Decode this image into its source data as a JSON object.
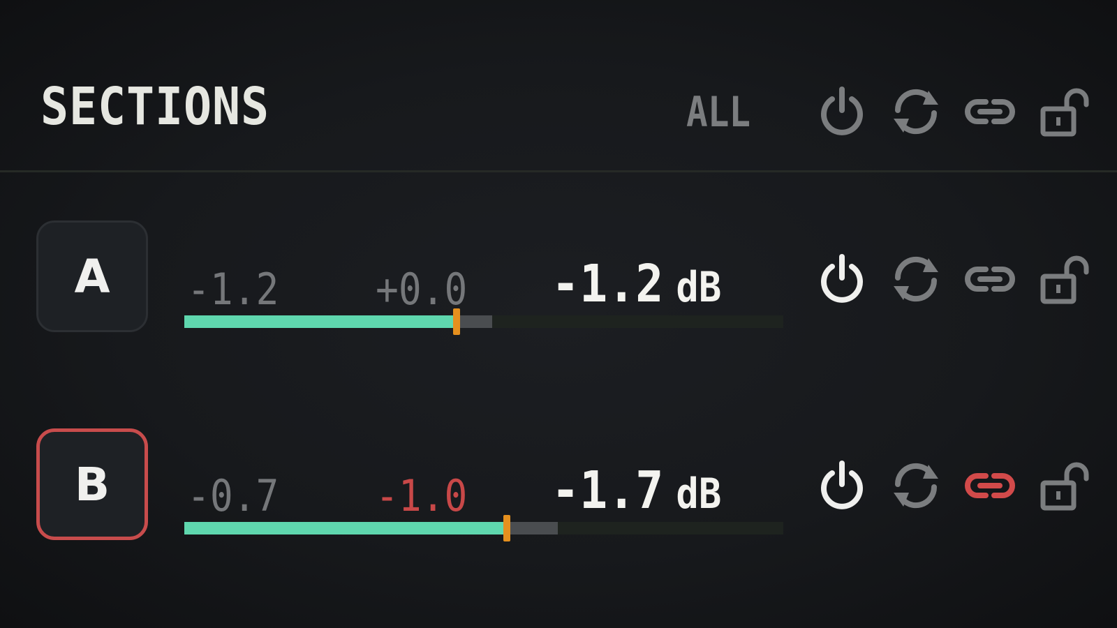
{
  "header": {
    "title": "SECTIONS",
    "all_label": "ALL",
    "icons": [
      "power-icon",
      "refresh-icon",
      "link-icon",
      "unlock-icon"
    ]
  },
  "sections": [
    {
      "label": "A",
      "active": false,
      "value_left": "-1.2",
      "value_mid": "+0.0",
      "value_total": "-1.2",
      "unit": "dB",
      "fill_fraction": 0.454,
      "ghost_fraction": 0.514,
      "power_on": true,
      "link_active": false
    },
    {
      "label": "B",
      "active": true,
      "value_left": "-0.7",
      "value_mid": "-1.0",
      "value_total": "-1.7",
      "unit": "dB",
      "fill_fraction": 0.539,
      "ghost_fraction": 0.623,
      "power_on": true,
      "link_active": true
    }
  ],
  "colors": {
    "fill": "#5fd7ae",
    "thumb": "#e5901e",
    "accent_red": "#c84c4c",
    "icon_dim": "#7b7d7f",
    "icon_bright": "#f0f0ee"
  }
}
